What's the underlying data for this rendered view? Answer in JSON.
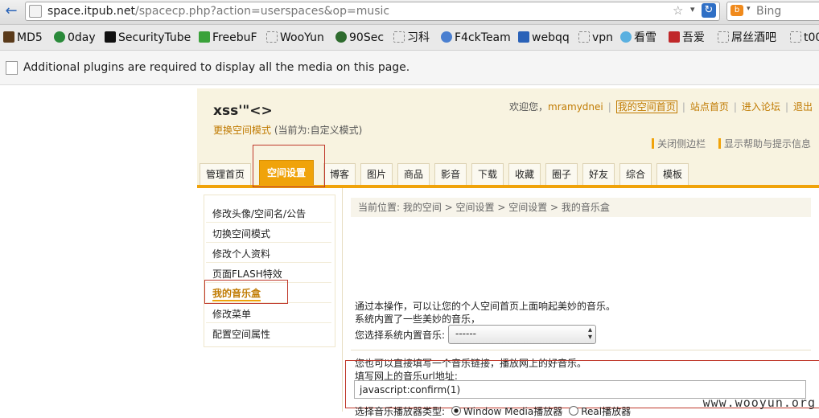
{
  "browser": {
    "url_host": "space.itpub.net",
    "url_path": "/spacecp.php?action=userspaces&op=music",
    "search_placeholder": "Bing",
    "bookmarks": [
      "MD5",
      "0day",
      "SecurityTube",
      "FreebuF",
      "WooYun",
      "90Sec",
      "习科",
      "F4ckTeam",
      "webqq",
      "vpn",
      "看雪",
      "吾爱",
      "屌丝酒吧",
      "t00"
    ],
    "plugin_message": "Additional plugins are required to display all the media on this page."
  },
  "header": {
    "space_title": "xss'\"<>",
    "switch_mode": "更换空间模式",
    "current_mode": "(当前为:自定义模式)",
    "welcome": "欢迎您，",
    "username": "mramydnei",
    "links": [
      "我的空间首页",
      "站点首页",
      "进入论坛",
      "退出"
    ],
    "side_links": [
      "关闭侧边栏",
      "显示帮助与提示信息"
    ]
  },
  "nav": {
    "tabs": [
      "管理首页",
      "空间设置",
      "博客",
      "图片",
      "商品",
      "影音",
      "下载",
      "收藏",
      "圈子",
      "好友",
      "综合",
      "模板"
    ],
    "active_tab": "空间设置"
  },
  "sidebar": {
    "items": [
      "修改头像/空间名/公告",
      "切换空间模式",
      "修改个人资料",
      "页面FLASH特效",
      "我的音乐盒",
      "修改菜单",
      "配置空间属性"
    ],
    "active_item": "我的音乐盒"
  },
  "content": {
    "breadcrumb": "当前位置: 我的空间 > 空间设置 > 空间设置 > 我的音乐盒",
    "intro_line1": "通过本操作，可以让您的个人空间首页上面响起美妙的音乐。",
    "intro_line2": "系统内置了一些美妙的音乐，",
    "select_label": "您选择系统内置音乐:",
    "select_value": "------",
    "url_hint": "您也可以直接填写一个音乐链接，播放网上的好音乐。",
    "url_label": "填写网上的音乐url地址:",
    "url_value": "javascript:confirm(1)",
    "player_label": "选择音乐播放器类型:",
    "player_options": [
      "Window Media播放器",
      "Real播放器"
    ]
  },
  "watermark": "www.wooyun.org",
  "colors": {
    "accent": "#f0a30a",
    "link": "#c07a00",
    "highlight_box": "#c0392b",
    "header_bg": "#f8f3e0"
  }
}
